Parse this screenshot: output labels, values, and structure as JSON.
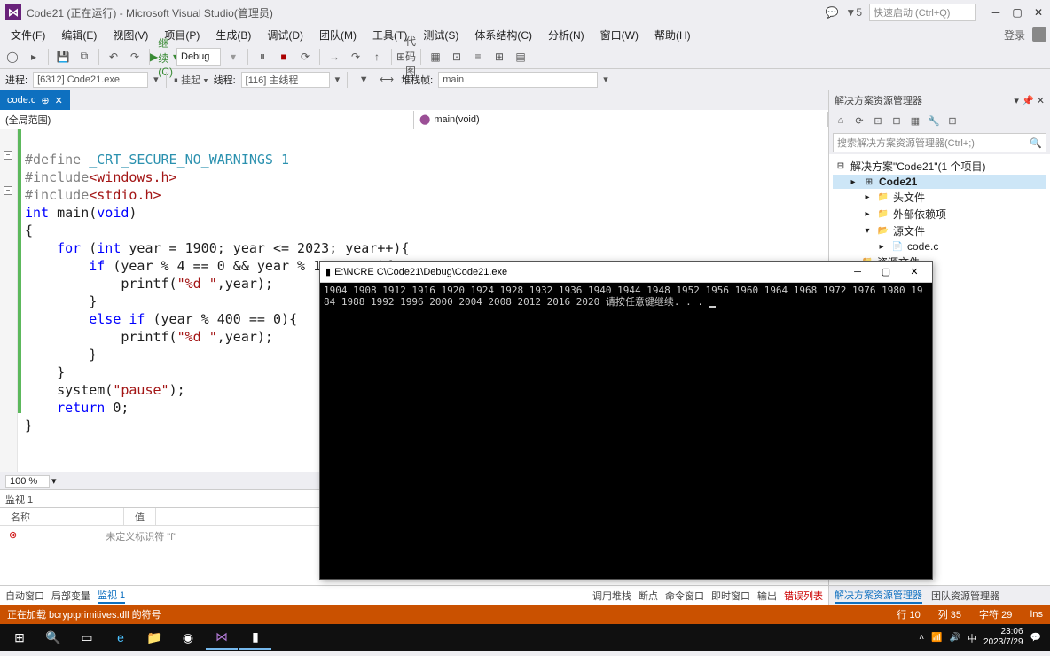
{
  "title": "Code21 (正在运行) - Microsoft Visual Studio(管理员)",
  "notif_count": "5",
  "quick_launch_placeholder": "快速启动 (Ctrl+Q)",
  "menu": {
    "file": "文件(F)",
    "edit": "编辑(E)",
    "view": "视图(V)",
    "project": "项目(P)",
    "build": "生成(B)",
    "debug": "调试(D)",
    "team": "团队(M)",
    "tools": "工具(T)",
    "test": "测试(S)",
    "arch": "体系结构(C)",
    "analyze": "分析(N)",
    "window": "窗口(W)",
    "help": "帮助(H)",
    "login": "登录"
  },
  "toolbar": {
    "continue": "继续(C)",
    "config": "Debug",
    "codemap": "代码图"
  },
  "debugbar": {
    "process_label": "进程:",
    "process_value": "[6312] Code21.exe",
    "suspend": "挂起",
    "thread_label": "线程:",
    "thread_value": "[116] 主线程",
    "stack_label": "堆栈帧:",
    "stack_value": "main"
  },
  "tab": {
    "filename": "code.c"
  },
  "nav": {
    "scope": "(全局范围)",
    "member_icon": "⬤",
    "member": "main(void)"
  },
  "code": {
    "l1a": "#define",
    "l1b": " _CRT_SECURE_NO_WARNINGS 1",
    "l2a": "#include",
    "l2b": "<windows.h>",
    "l3a": "#include",
    "l3b": "<stdio.h>",
    "l4a": "int",
    "l4b": " main(",
    "l4c": "void",
    "l4d": ")",
    "l5": "{",
    "l6a": "    for",
    "l6b": " (",
    "l6c": "int",
    "l6d": " year = 1900; year <= 2023; year++){",
    "l7a": "        if",
    "l7b": " (year % 4 == 0 && year % 100 != 0){",
    "l8a": "            printf(",
    "l8b": "\"%d \"",
    "l8c": ",year);",
    "l9": "        }",
    "l10a": "        else if",
    "l10b": " (year % 400 == 0){",
    "l11a": "            printf(",
    "l11b": "\"%d \"",
    "l11c": ",year);",
    "l12": "        }",
    "l13": "    }",
    "l14a": "    system(",
    "l14b": "\"pause\"",
    "l14c": ");",
    "l15a": "    return",
    "l15b": " 0;",
    "l16": "}"
  },
  "zoom": "100 %",
  "watch": {
    "title": "监视 1",
    "col_name": "名称",
    "col_value": "值",
    "err_text": "未定义标识符 \"f\""
  },
  "bottom_tabs": {
    "auto": "自动窗口",
    "locals": "局部变量",
    "watch": "监视 1",
    "callstack": "调用堆栈",
    "break": "断点",
    "cmd": "命令窗口",
    "immediate": "即时窗口",
    "output": "输出",
    "errors": "错误列表"
  },
  "solution": {
    "title": "解决方案资源管理器",
    "search_placeholder": "搜索解决方案资源管理器(Ctrl+;)",
    "root": "解决方案\"Code21\"(1 个项目)",
    "project": "Code21",
    "headers": "头文件",
    "external": "外部依赖项",
    "sources": "源文件",
    "sourcefile": "code.c",
    "resources": "资源文件",
    "tab_sol": "解决方案资源管理器",
    "tab_team": "团队资源管理器"
  },
  "status": {
    "loading": "正在加载 bcryptprimitives.dll 的符号",
    "line": "行 10",
    "col": "列 35",
    "char": "字符 29",
    "ins": "Ins"
  },
  "console": {
    "title": "E:\\NCRE C\\Code21\\Debug\\Code21.exe",
    "output": "1904 1908 1912 1916 1920 1924 1928 1932 1936 1940 1944 1948 1952 1956 1960 1964 1968 1972 1976 1980 1984 1988 1992 1996 2000 2004 2008 2012 2016 2020 请按任意键继续. . . "
  },
  "taskbar": {
    "time": "23:06",
    "date": "2023/7/29",
    "ime": "中"
  }
}
